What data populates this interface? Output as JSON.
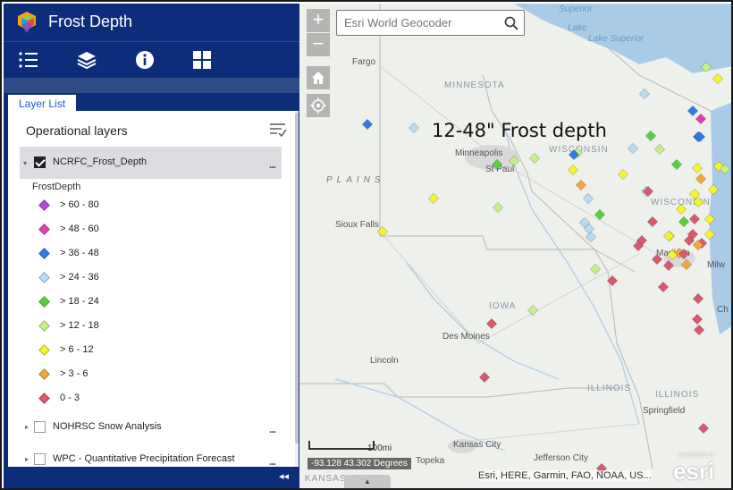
{
  "app": {
    "title": "Frost Depth",
    "colors": {
      "header": "#0d2d7a",
      "tab_strip": "#2e4b86",
      "accent": "#1c5bd1"
    }
  },
  "toolbar": {
    "items": [
      {
        "name": "legend-list-icon",
        "label": "Legend"
      },
      {
        "name": "layers-icon",
        "label": "Layer List"
      },
      {
        "name": "info-icon",
        "label": "About"
      },
      {
        "name": "grid-icon",
        "label": "More"
      }
    ]
  },
  "panel": {
    "tab_label": "Layer List",
    "section_title": "Operational layers",
    "layers": [
      {
        "name": "NCRFC_Frost_Depth",
        "checked": true,
        "expanded": true
      },
      {
        "name": "NOHRSC Snow Analysis",
        "checked": false,
        "expanded": false
      },
      {
        "name": "WPC - Quantitative Precipitation Forecast",
        "checked": false,
        "expanded": false
      }
    ],
    "legend": {
      "field": "FrostDepth",
      "items": [
        {
          "label": "> 60 - 80",
          "color": "#b548d8"
        },
        {
          "label": "> 48 - 60",
          "color": "#e03fb4"
        },
        {
          "label": "> 36 - 48",
          "color": "#2f7ce6"
        },
        {
          "label": "> 24 - 36",
          "color": "#b9dcf3"
        },
        {
          "label": "> 18 - 24",
          "color": "#57d13b"
        },
        {
          "label": "> 12 - 18",
          "color": "#c6f08a"
        },
        {
          "label": "> 6 - 12",
          "color": "#f4f430"
        },
        {
          "label": "> 3 - 6",
          "color": "#f3a73c"
        },
        {
          "label": "0 - 3",
          "color": "#d9596e"
        }
      ]
    },
    "more_label": "..."
  },
  "map": {
    "search_placeholder": "Esri World Geocoder",
    "annotation": "12-48\" Frost depth",
    "zoom_in": "+",
    "zoom_out": "−",
    "places": {
      "minnesota": "MINNESOTA",
      "wisconsin": "WISCONSIN",
      "wisconsin2": "WISCONSIN",
      "iowa": "IOWA",
      "illinois": "ILLINOIS",
      "illinois2": "ILLINOIS",
      "plains": "PLAINS",
      "lake_superior": "Lake\nSuperior",
      "lake_superior_label": "Lake Superior",
      "superior_top": "Superior",
      "lake_top": "Lake",
      "fargo": "Fargo",
      "minneapolis": "Minneapolis",
      "st_paul": "St Paul",
      "sioux_falls": "Sioux Falls",
      "des_moines": "Des Moines",
      "lincoln": "Lincoln",
      "madison": "Madison",
      "milw": "Milw",
      "springfield": "Springfield",
      "kansas_city": "Kansas City",
      "topeka": "Topeka",
      "jefferson_city": "Jefferson City",
      "kansas": "KANSAS",
      "ch": "Ch"
    },
    "scale_label": "100mi",
    "coordinates": "-93.128 43.302 Degrees",
    "attribution": "Esri, HERE, Garmin, FAO, NOAA, US...",
    "logo_text": "esri",
    "powered_by": "POWERED BY",
    "collapse_label": "◂◂"
  }
}
